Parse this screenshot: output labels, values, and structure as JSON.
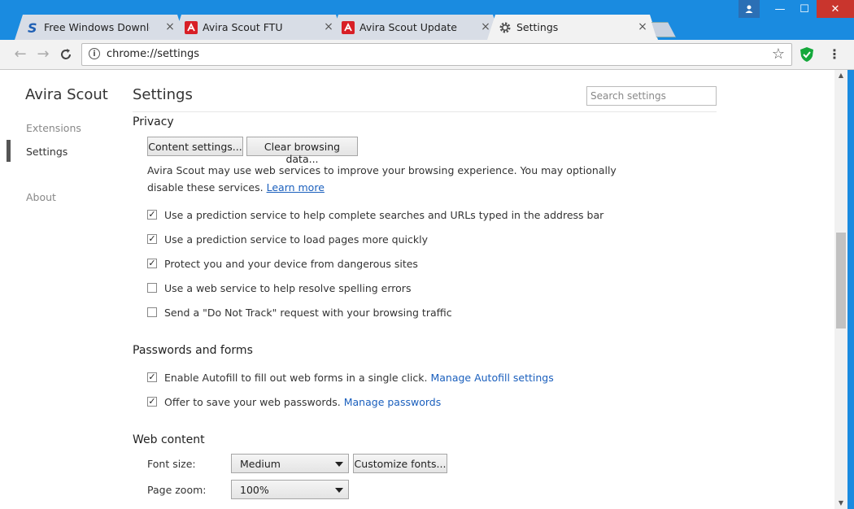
{
  "colors": {
    "titlebar": "#1a8be0",
    "link": "#1a5fbd",
    "avira_red": "#d81f26",
    "shield_green": "#14a83b",
    "close_red": "#c9352d"
  },
  "tabs": [
    {
      "label": "Free Windows Downloads",
      "icon": "softpedia-s-icon"
    },
    {
      "label": "Avira Scout FTU",
      "icon": "avira-icon"
    },
    {
      "label": "Avira Scout Update",
      "icon": "avira-icon"
    },
    {
      "label": "Settings",
      "icon": "gear-icon",
      "active": true
    }
  ],
  "tab_close_glyph": "×",
  "window": {
    "minimize": "—",
    "maximize": "☐",
    "close": "✕"
  },
  "toolbar": {
    "url": "chrome://settings"
  },
  "sidebar": {
    "brand": "Avira Scout",
    "items": [
      "Extensions",
      "Settings",
      "About"
    ],
    "active": "Settings"
  },
  "main": {
    "title": "Settings",
    "search_placeholder": "Search settings",
    "privacy": {
      "heading": "Privacy",
      "content_settings_btn": "Content settings...",
      "clear_data_btn": "Clear browsing data...",
      "desc": "Avira Scout may use web services to improve your browsing experience. You may optionally disable these services.",
      "learn_more": "Learn more",
      "options": [
        {
          "label": "Use a prediction service to help complete searches and URLs typed in the address bar",
          "checked": true
        },
        {
          "label": "Use a prediction service to load pages more quickly",
          "checked": true
        },
        {
          "label": "Protect you and your device from dangerous sites",
          "checked": true
        },
        {
          "label": "Use a web service to help resolve spelling errors",
          "checked": false
        },
        {
          "label": "Send a \"Do Not Track\" request with your browsing traffic",
          "checked": false
        }
      ]
    },
    "passwords": {
      "heading": "Passwords and forms",
      "autofill_label": "Enable Autofill to fill out web forms in a single click.",
      "autofill_link": "Manage Autofill settings",
      "autofill_checked": true,
      "passwords_label": "Offer to save your web passwords.",
      "passwords_link": "Manage passwords",
      "passwords_checked": true
    },
    "web_content": {
      "heading": "Web content",
      "font_size_label": "Font size:",
      "font_size_value": "Medium",
      "customize_fonts_btn": "Customize fonts...",
      "page_zoom_label": "Page zoom:",
      "page_zoom_value": "100%"
    }
  }
}
